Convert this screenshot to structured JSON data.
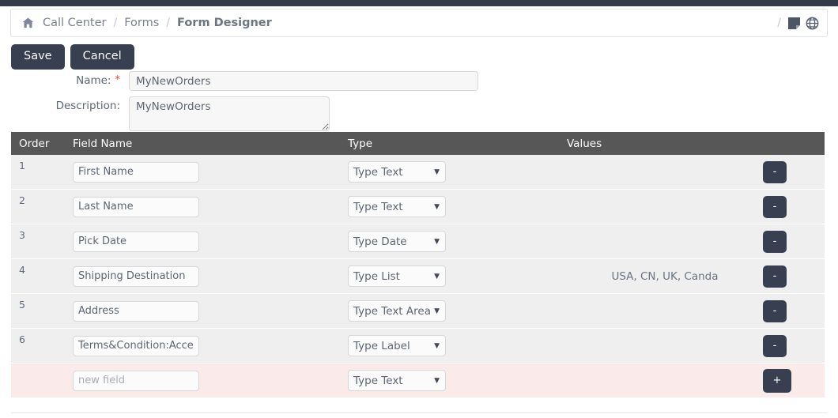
{
  "breadcrumb": {
    "home_icon": "home-icon",
    "items": [
      {
        "label": "Call Center",
        "current": false
      },
      {
        "label": "Forms",
        "current": false
      },
      {
        "label": "Form Designer",
        "current": true
      }
    ],
    "separator": "/",
    "trailing_separator": "/",
    "right_icons": [
      {
        "name": "note-icon"
      },
      {
        "name": "globe-icon"
      }
    ]
  },
  "toolbar": {
    "save_label": "Save",
    "cancel_label": "Cancel"
  },
  "form": {
    "name_label": "Name:",
    "name_required_marker": "*",
    "name_value": "MyNewOrders",
    "name_placeholder": "",
    "description_label": "Description:",
    "description_value": "MyNewOrders",
    "description_placeholder": ""
  },
  "table": {
    "headers": {
      "order": "Order",
      "field_name": "Field Name",
      "type": "Type",
      "values": "Values",
      "action": ""
    },
    "remove_label": "-",
    "add_label": "+",
    "caret": "▼",
    "rows": [
      {
        "order": "1",
        "field_name": "First Name",
        "type": "Type Text",
        "values": ""
      },
      {
        "order": "2",
        "field_name": "Last Name",
        "type": "Type Text",
        "values": ""
      },
      {
        "order": "3",
        "field_name": "Pick Date",
        "type": "Type Date",
        "values": ""
      },
      {
        "order": "4",
        "field_name": "Shipping Destination",
        "type": "Type List",
        "values": "USA, CN, UK, Canda"
      },
      {
        "order": "5",
        "field_name": "Address",
        "type": "Type Text Area",
        "values": ""
      },
      {
        "order": "6",
        "field_name": "Terms&Condition:Accepted",
        "type": "Type Label",
        "values": ""
      }
    ],
    "new_row": {
      "order": "",
      "field_name": "",
      "field_name_placeholder": "new field",
      "type": "Type Text",
      "values": ""
    }
  },
  "colors": {
    "top_strip": "#343a46",
    "button_dark": "#373f50",
    "table_header": "#575757",
    "row_bg": "#efeff0",
    "new_row_bg": "#fbeaea",
    "required_star": "#e8453c"
  }
}
